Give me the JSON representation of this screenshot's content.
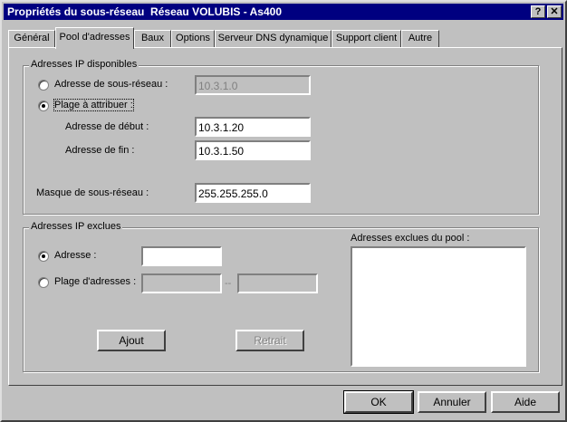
{
  "window": {
    "title": "Propriétés du sous-réseau  Réseau VOLUBIS - As400",
    "help_btn": "?",
    "close_btn": "✕"
  },
  "tabs": [
    "Général",
    "Pool d'adresses",
    "Baux",
    "Options",
    "Serveur DNS dynamique",
    "Support client",
    "Autre"
  ],
  "available": {
    "title": "Adresses IP disponibles",
    "subnet_radio_label": "Adresse de sous-réseau :",
    "subnet_value": "10.3.1.0",
    "range_radio_label": "Plage à attribuer :",
    "start_label": "Adresse de début :",
    "start_value": "10.3.1.20",
    "end_label": "Adresse de fin :",
    "end_value": "10.3.1.50",
    "mask_label": "Masque de sous-réseau :",
    "mask_value": "255.255.255.0"
  },
  "excluded": {
    "title": "Adresses IP exclues",
    "address_label": "Adresse :",
    "address_value": "",
    "range_label": "Plage d'adresses :",
    "range_from": "",
    "range_sep": "--",
    "range_to": "",
    "add_btn": "Ajout",
    "remove_btn": "Retrait",
    "pool_label": "Adresses exclues du pool :"
  },
  "footer": {
    "ok": "OK",
    "cancel": "Annuler",
    "help": "Aide"
  }
}
